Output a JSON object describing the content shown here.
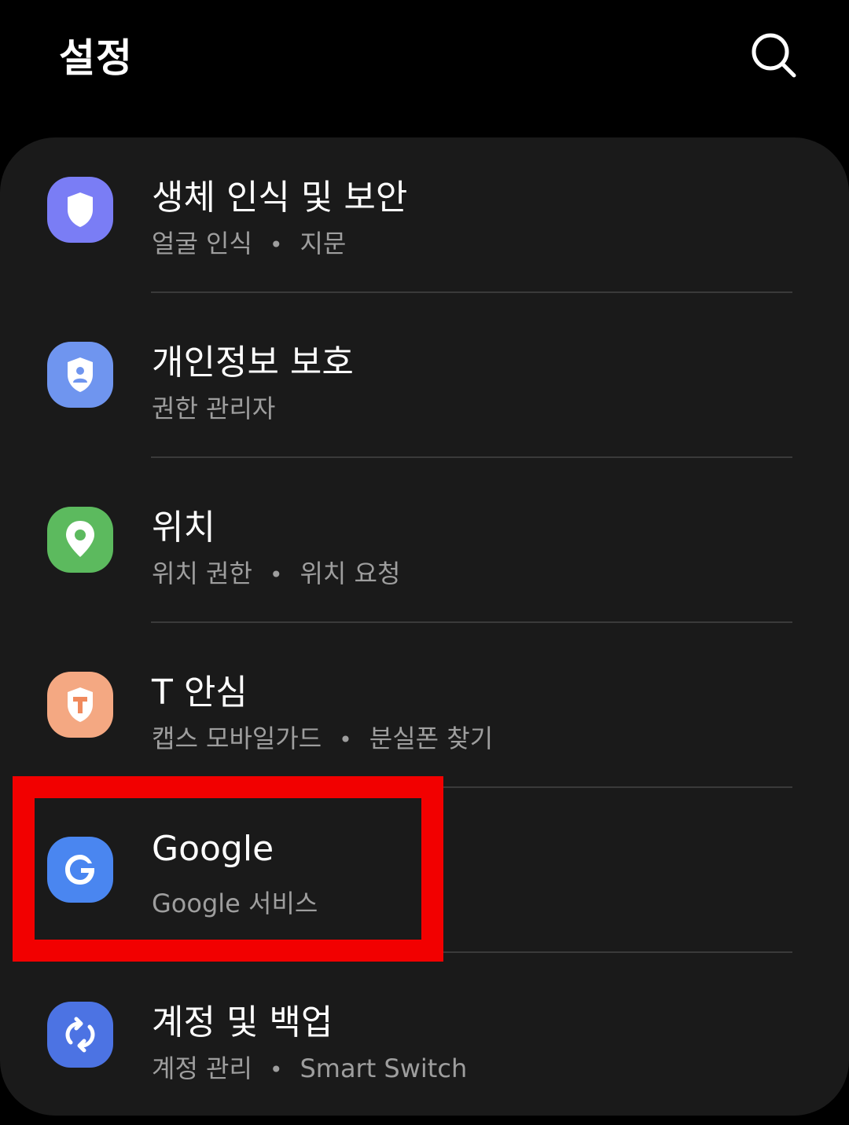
{
  "header": {
    "title": "설정",
    "search_icon": "search-icon"
  },
  "settings": {
    "items": [
      {
        "id": "biometrics-security",
        "title": "생체 인식 및 보안",
        "subtitle_parts": [
          "얼굴 인식",
          "지문"
        ],
        "icon": "shield-icon",
        "icon_color": "#7a7df5"
      },
      {
        "id": "privacy",
        "title": "개인정보 보호",
        "subtitle_parts": [
          "권한 관리자"
        ],
        "icon": "privacy-shield-icon",
        "icon_color": "#6f95ef"
      },
      {
        "id": "location",
        "title": "위치",
        "subtitle_parts": [
          "위치 권한",
          "위치 요청"
        ],
        "icon": "location-pin-icon",
        "icon_color": "#5cba5e"
      },
      {
        "id": "t-ansim",
        "title": "T 안심",
        "subtitle_parts": [
          "캡스 모바일가드",
          "분실폰 찾기"
        ],
        "icon": "t-ansim-shield-icon",
        "icon_color": "#f4a882"
      },
      {
        "id": "google",
        "title": "Google",
        "subtitle_parts": [
          "Google 서비스"
        ],
        "icon": "google-icon",
        "icon_color": "#4a86f0",
        "highlighted": true
      },
      {
        "id": "accounts-backup",
        "title": "계정 및 백업",
        "subtitle_parts": [
          "계정 관리",
          "Smart Switch"
        ],
        "icon": "sync-icon",
        "icon_color": "#4c73e3"
      }
    ],
    "separator": "•"
  },
  "highlight_color": "#f20000"
}
